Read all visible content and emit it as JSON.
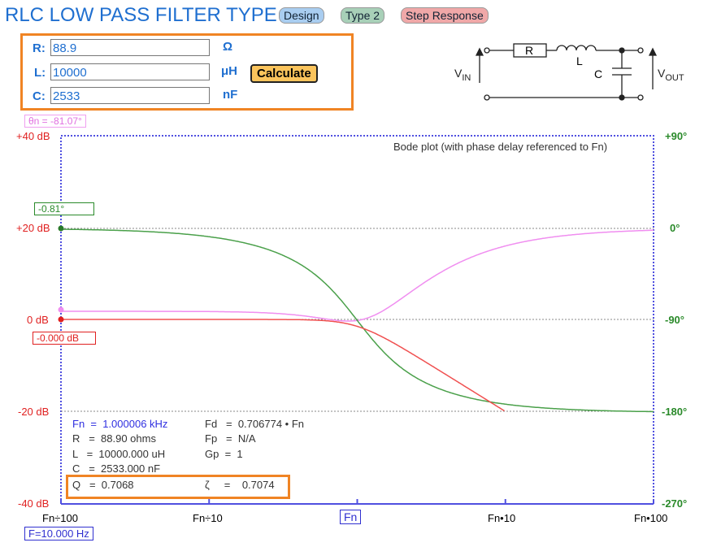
{
  "header": {
    "title": "RLC LOW PASS FILTER TYPE 1",
    "buttons": [
      "Design",
      "Type 2",
      "Step Response"
    ]
  },
  "inputs": {
    "R": {
      "label": "R:",
      "value": "88.9",
      "unit": "Ω"
    },
    "L": {
      "label": "L:",
      "value": "10000",
      "unit": "μH"
    },
    "C": {
      "label": "C:",
      "value": "2533",
      "unit": "nF"
    },
    "calculate_label": "Calculate"
  },
  "circuit": {
    "r": "R",
    "l": "L",
    "c": "C",
    "vin": "V",
    "vin_sub": "IN",
    "vout": "V",
    "vout_sub": "OUT"
  },
  "plot": {
    "caption": "Bode plot (with phase delay referenced to Fn)",
    "left_ticks": [
      "+40 dB",
      "+20 dB",
      "0 dB",
      "-20 dB",
      "-40 dB"
    ],
    "right_ticks": [
      "+90°",
      "0°",
      "-90°",
      "-180°",
      "-270°"
    ],
    "x_ticks": [
      "Fn÷100",
      "Fn÷10",
      "Fn",
      "Fn•10",
      "Fn•100"
    ],
    "theta_n": "θn = -81.07°",
    "phase_readout": "-0.81°",
    "mag_readout": "-0.000 dB",
    "freq_readout": "F=10.000 Hz",
    "zeta": 0.7074,
    "colors": {
      "magnitude": "#f05050",
      "phase": "#4aa04a",
      "phase_delay": "#f08ef0",
      "axis": "#5050e0"
    }
  },
  "results": {
    "fn": "Fn  =  1.000006 kHz",
    "fd": "Fd   =  0.706774 • Fn",
    "r": "R   =  88.90 ohms",
    "fp": "Fp   =  N/A",
    "l": "L   =  10000.000 uH",
    "gp": "Gp  =  1",
    "c": "C   =  2533.000 nF",
    "q": "Q   =  0.7068",
    "z": "ζ     =    0.7074"
  }
}
